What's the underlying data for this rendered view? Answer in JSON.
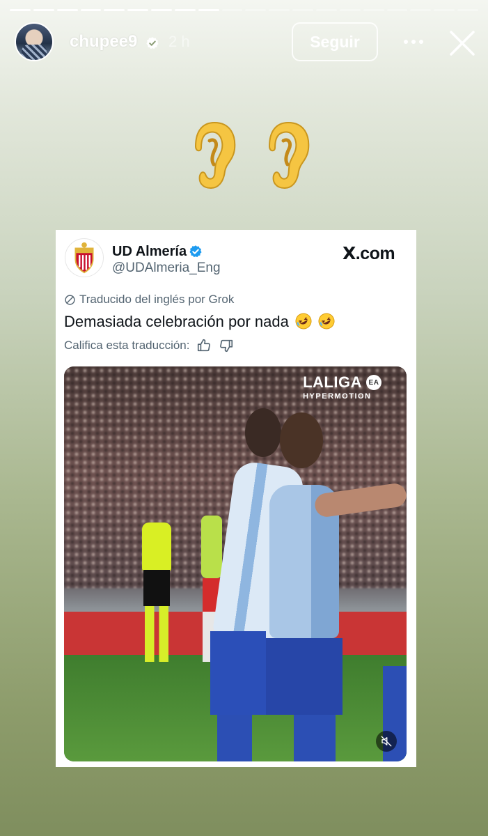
{
  "story": {
    "progress_total": 20,
    "progress_done": 9,
    "username": "chupee9",
    "time": "2 h",
    "follow_label": "Seguir",
    "icons": [
      "verified-icon",
      "more-icon",
      "close-icon",
      "ear-icon"
    ]
  },
  "tweet": {
    "account_name": "UD Almería",
    "handle": "@UDAlmeria_Eng",
    "source": "X.com",
    "translated_label": "Traducido del inglés por Grok",
    "text": "Demasiada celebración por nada",
    "rate_label": "Califica esta traducción:",
    "media": {
      "logo_main": "LALIGA",
      "logo_badge": "EA",
      "logo_sub": "HYPERMOTION"
    }
  },
  "colors": {
    "verified_blue": "#1d9bf0",
    "text_primary": "#0f1419",
    "text_secondary": "#536471"
  }
}
